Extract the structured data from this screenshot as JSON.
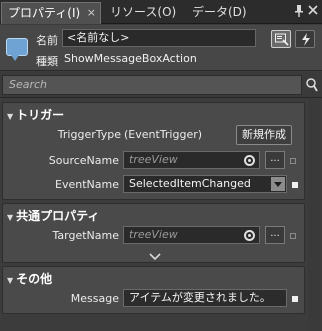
{
  "tabs": [
    {
      "label": "プロパティ(I)",
      "active": true,
      "close": "×"
    },
    {
      "label": "リソース(O)",
      "active": false
    },
    {
      "label": "データ(D)",
      "active": false
    }
  ],
  "header": {
    "name_label": "名前",
    "name_value": "<名前なし>",
    "type_label": "種類",
    "type_value": "ShowMessageBoxAction"
  },
  "search": {
    "placeholder": "Search"
  },
  "sections": {
    "trigger": {
      "title": "トリガー",
      "trigger_type_label": "TriggerType",
      "trigger_type_value": "(EventTrigger)",
      "new_button": "新規作成",
      "source_name_label": "SourceName",
      "source_name_placeholder": "treeView",
      "event_name_label": "EventName",
      "event_name_value": "SelectedItemChanged"
    },
    "common": {
      "title": "共通プロパティ",
      "target_name_label": "TargetName",
      "target_name_placeholder": "treeView"
    },
    "other": {
      "title": "その他",
      "message_label": "Message",
      "message_value": "アイテムが変更されました。"
    }
  },
  "ellipsis": "...",
  "colors": {
    "accent": "#6fa3d4",
    "background": "#3c3c3c",
    "section": "#4a4a4a"
  }
}
